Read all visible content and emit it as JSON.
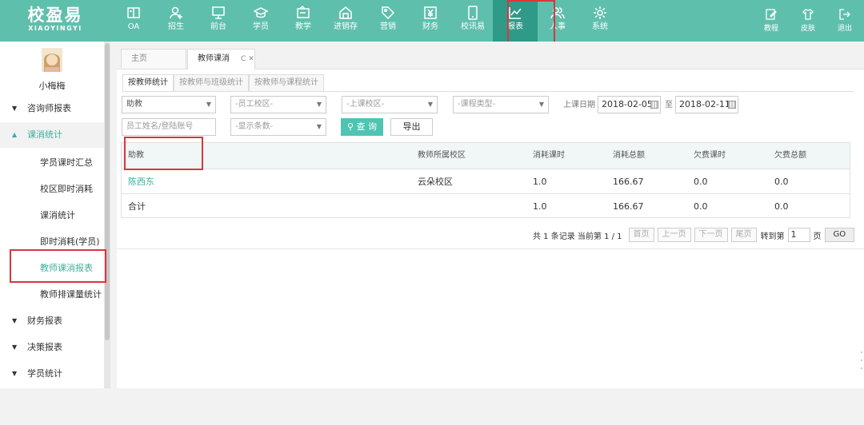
{
  "logo": {
    "cn": "校盈易",
    "en": "XIAOYINGYI"
  },
  "nav": [
    {
      "label": "OA",
      "icon": "oa-icon"
    },
    {
      "label": "招生",
      "icon": "enroll-icon"
    },
    {
      "label": "前台",
      "icon": "monitor-icon"
    },
    {
      "label": "学员",
      "icon": "graduation-cap-icon"
    },
    {
      "label": "教学",
      "icon": "teaching-icon"
    },
    {
      "label": "进销存",
      "icon": "warehouse-icon"
    },
    {
      "label": "营销",
      "icon": "tag-icon"
    },
    {
      "label": "财务",
      "icon": "yen-icon"
    },
    {
      "label": "校讯易",
      "icon": "phone-icon"
    },
    {
      "label": "报表",
      "icon": "line-chart-icon",
      "active": true
    },
    {
      "label": "人事",
      "icon": "people-icon"
    },
    {
      "label": "系统",
      "icon": "gear-icon"
    }
  ],
  "tools": [
    {
      "label": "教程",
      "icon": "tutorial-icon"
    },
    {
      "label": "皮肤",
      "icon": "shirt-icon"
    },
    {
      "label": "退出",
      "icon": "logout-icon"
    }
  ],
  "user": {
    "name": "小梅梅"
  },
  "sidebar": {
    "groups": [
      {
        "label": "咨询师报表"
      },
      {
        "label": "课消统计"
      },
      {
        "label": "财务报表"
      },
      {
        "label": "决策报表"
      },
      {
        "label": "学员统计"
      }
    ],
    "sub_items": [
      {
        "label": "学员课时汇总"
      },
      {
        "label": "校区即时消耗"
      },
      {
        "label": "课消统计"
      },
      {
        "label": "即时消耗(学员)"
      },
      {
        "label": "教师课消报表"
      },
      {
        "label": "教师排课量统计"
      }
    ]
  },
  "page_tabs": [
    {
      "label": "主页"
    },
    {
      "label": "教师课消",
      "refresh": "C",
      "close": "✕"
    }
  ],
  "sub_tabs": [
    {
      "label": "按教师统计"
    },
    {
      "label": "按教师与班级统计"
    },
    {
      "label": "按教师与课程统计"
    }
  ],
  "filters": {
    "role": "助教",
    "campus": "-员工校区-",
    "class_campus": "-上课校区-",
    "course_type": "-课程类型-",
    "date_label": "上课日期",
    "date_from": "2018-02-05",
    "date_to_label": "至",
    "date_to": "2018-02-11",
    "name_placeholder": "员工姓名/登陆账号",
    "page_size": "-显示条数-",
    "query_label": "查 询",
    "export_label": "导出"
  },
  "table": {
    "headers": [
      "助教",
      "教师所属校区",
      "消耗课时",
      "消耗总额",
      "欠费课时",
      "欠费总额"
    ],
    "rows": [
      [
        "陈西东",
        "云朵校区",
        "1.0",
        "166.67",
        "0.0",
        "0.0"
      ],
      [
        "合计",
        "",
        "1.0",
        "166.67",
        "0.0",
        "0.0"
      ]
    ]
  },
  "pager": {
    "summary": "共 1 条记录 当前第 1 / 1",
    "first": "首页",
    "prev": "上一页",
    "next": "下一页",
    "last": "尾页",
    "goto_label": "转到第",
    "page_value": "1",
    "page_unit": "页",
    "go": "GO"
  },
  "colors": {
    "topbar": "#5fbfad",
    "active_nav": "#2f9a87",
    "accent": "#3fae9c",
    "highlight": "#d9363e"
  }
}
